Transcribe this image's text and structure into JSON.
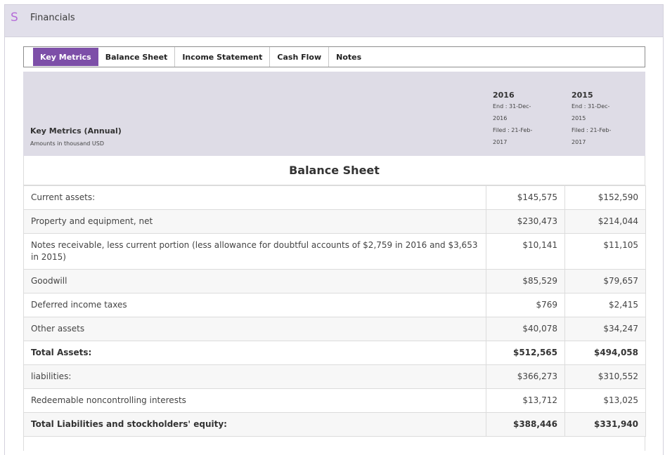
{
  "app": {
    "logo": "S",
    "title": "Financials"
  },
  "tabs": [
    {
      "label": "Key Metrics",
      "active": true
    },
    {
      "label": "Balance Sheet",
      "active": false
    },
    {
      "label": "Income Statement",
      "active": false
    },
    {
      "label": "Cash Flow",
      "active": false
    },
    {
      "label": "Notes",
      "active": false
    }
  ],
  "key_metrics": {
    "title": "Key Metrics (Annual)",
    "subtitle": "Amounts in thousand USD",
    "columns": [
      {
        "year": "2016",
        "end_line1": "End : 31-Dec-",
        "end_line2": "2016",
        "filed_line1": "Filed : 21-Feb-",
        "filed_line2": "2017"
      },
      {
        "year": "2015",
        "end_line1": "End : 31-Dec-",
        "end_line2": "2015",
        "filed_line1": "Filed : 21-Feb-",
        "filed_line2": "2017"
      }
    ]
  },
  "section_title": "Balance Sheet",
  "rows": [
    {
      "label": "Current assets:",
      "v2016": "$145,575",
      "v2015": "$152,590",
      "bold": false
    },
    {
      "label": "Property and equipment, net",
      "v2016": "$230,473",
      "v2015": "$214,044",
      "bold": false
    },
    {
      "label": "Notes receivable, less current portion (less allowance for doubtful accounts of $2,759 in 2016 and $3,653 in 2015)",
      "v2016": "$10,141",
      "v2015": "$11,105",
      "bold": false
    },
    {
      "label": "Goodwill",
      "v2016": "$85,529",
      "v2015": "$79,657",
      "bold": false
    },
    {
      "label": "Deferred income taxes",
      "v2016": "$769",
      "v2015": "$2,415",
      "bold": false
    },
    {
      "label": "Other assets",
      "v2016": "$40,078",
      "v2015": "$34,247",
      "bold": false
    },
    {
      "label": "Total Assets:",
      "v2016": "$512,565",
      "v2015": "$494,058",
      "bold": true
    },
    {
      "label": "liabilities:",
      "v2016": "$366,273",
      "v2015": "$310,552",
      "bold": false
    },
    {
      "label": "Redeemable noncontrolling interests",
      "v2016": "$13,712",
      "v2015": "$13,025",
      "bold": false
    },
    {
      "label": "Total Liabilities and stockholders' equity:",
      "v2016": "$388,446",
      "v2015": "$331,940",
      "bold": true
    }
  ],
  "colors": {
    "header_bg": "#e1dfea",
    "accent": "#7d4fa8",
    "logo": "#b56cd8",
    "metrics_header_bg": "#dedce6"
  }
}
